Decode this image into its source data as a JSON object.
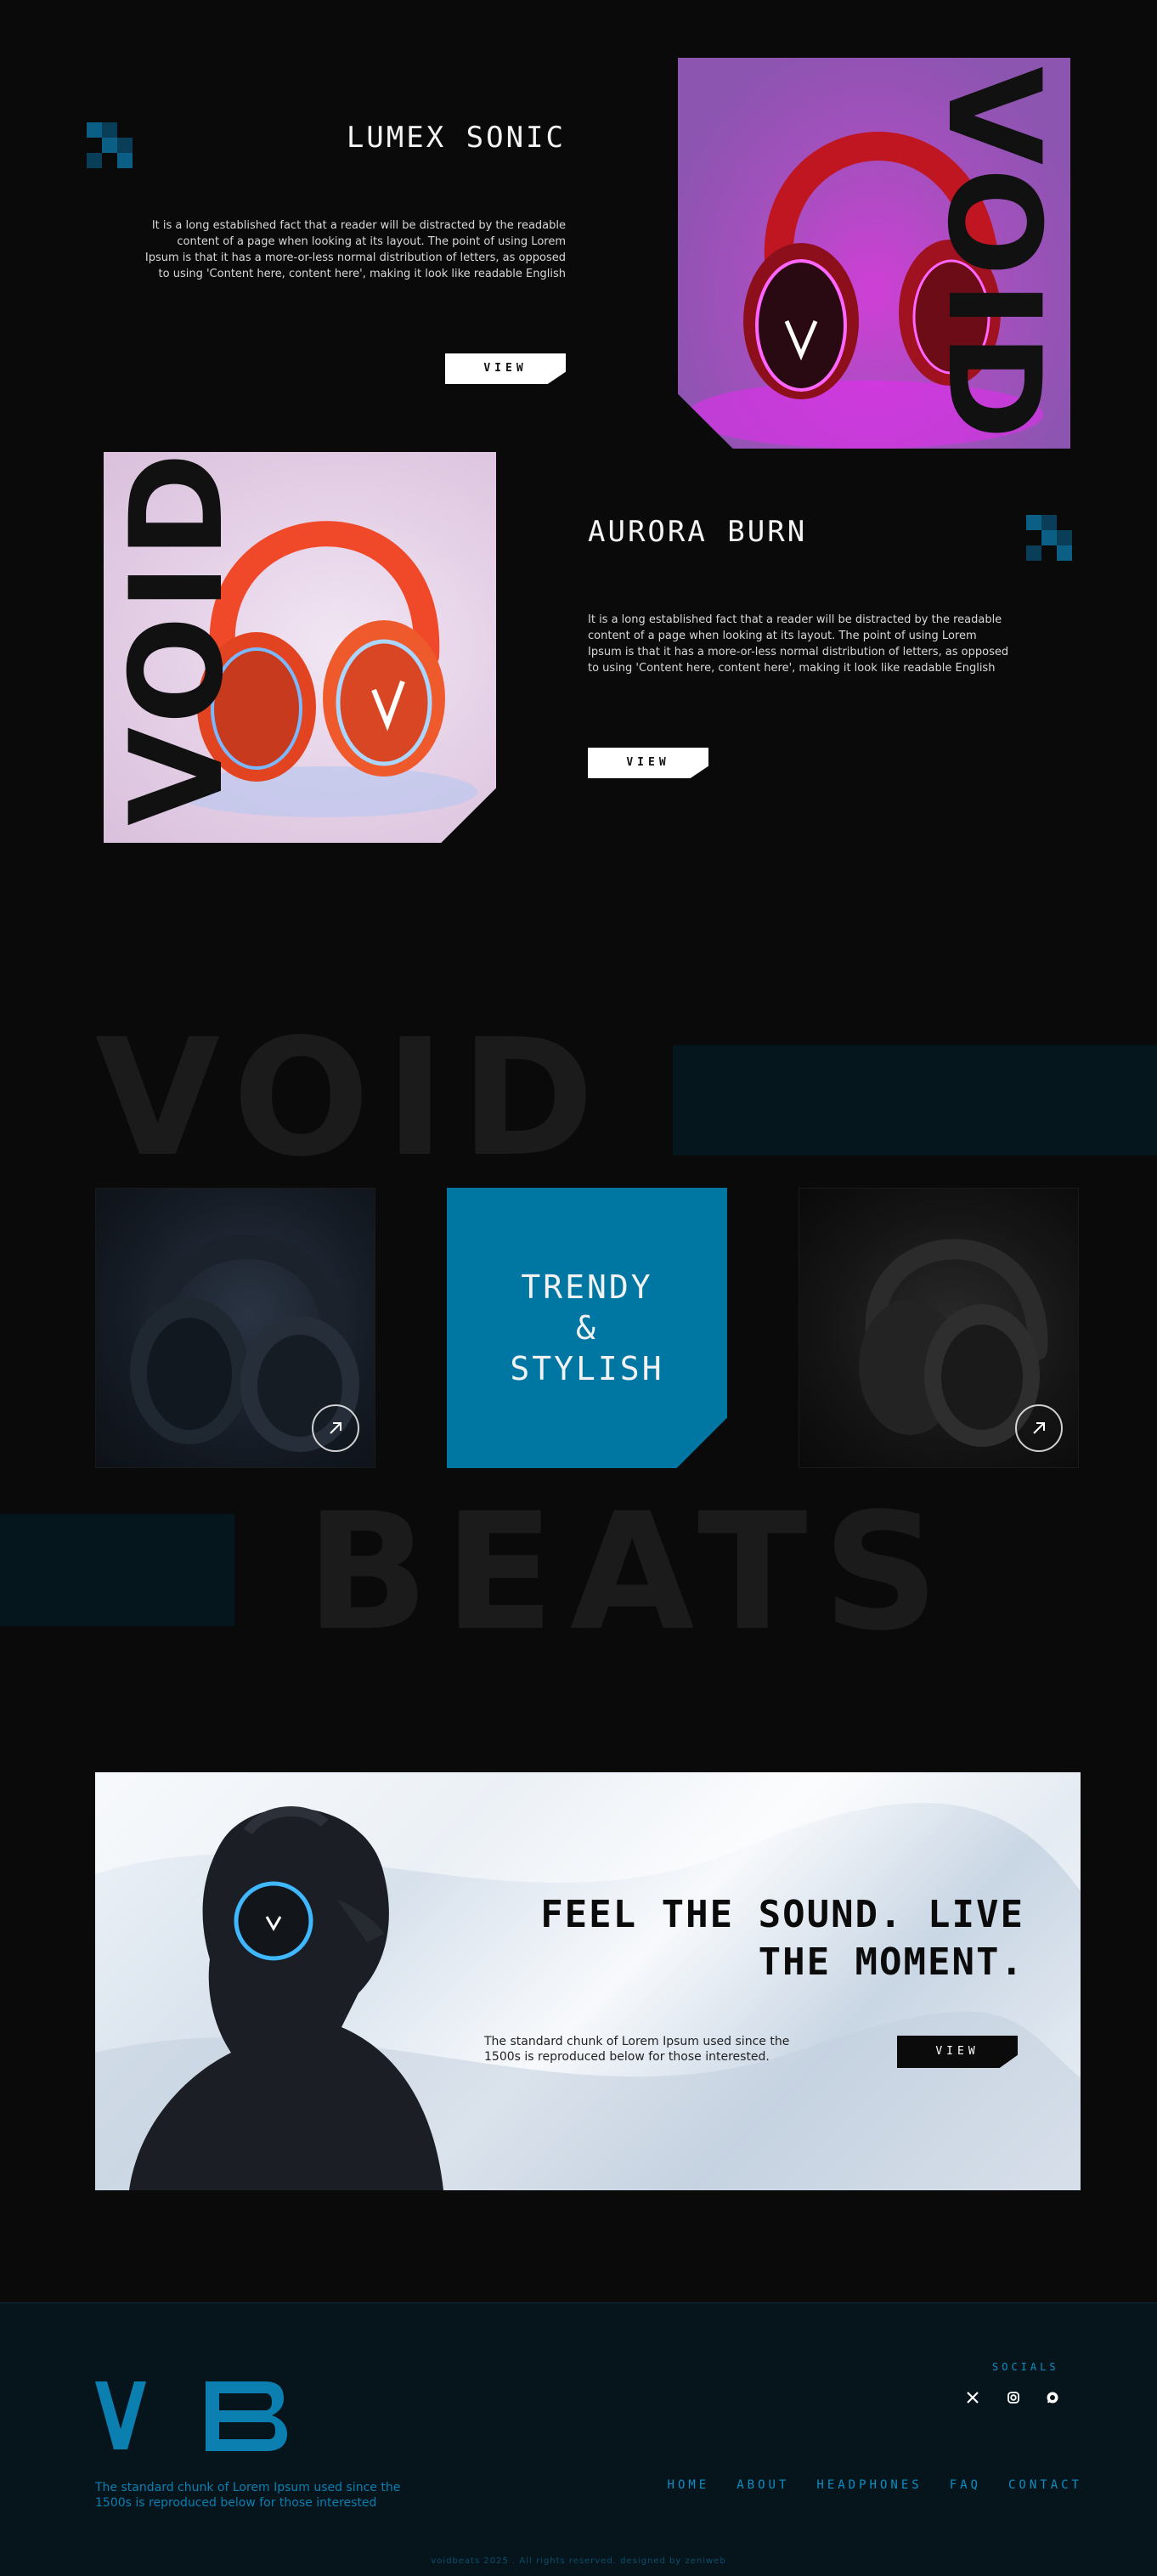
{
  "colors": {
    "background": "#0a0a0a",
    "accent": "#0077a3",
    "footer": "#06141c",
    "footer_text": "#0b8fc4"
  },
  "product1": {
    "title": "LUMEX SONIC",
    "desc": "It is a long established fact that a reader will be distracted by the readable content of a page when looking at its layout. The point of using Lorem Ipsum is that it has a more-or-less normal distribution of letters, as opposed to using 'Content here, content here', making it look like readable English",
    "button": "VIEW",
    "image_word": "VOID"
  },
  "product2": {
    "title": "AURORA BURN",
    "desc": "It is a long established fact that a reader will be distracted by the readable content of a page when looking at its layout. The point of using Lorem Ipsum is that it has a more-or-less normal distribution of letters, as opposed to using 'Content here, content here', making it look like readable English",
    "button": "VIEW",
    "image_word": "VOID"
  },
  "showcase": {
    "word_top": "VOID",
    "word_bottom": "BEATS",
    "center_line1": "TRENDY",
    "center_line2": "&",
    "center_line3": "STYLISH"
  },
  "banner": {
    "headline_line1": "FEEL THE SOUND. LIVE",
    "headline_line2": "THE MOMENT.",
    "text": "The standard chunk of Lorem Ipsum used since the 1500s is reproduced below for those interested.",
    "button": "VIEW"
  },
  "footer": {
    "logo": "VB",
    "tagline": "The standard chunk of Lorem Ipsum used since the 1500s is reproduced below for those interested",
    "socials_label": "SOCIALS",
    "socials": [
      "x-icon",
      "instagram-icon",
      "whatsapp-icon"
    ],
    "nav": [
      "HOME",
      "ABOUT",
      "HEADPHONES",
      "FAQ",
      "CONTACT"
    ],
    "copyright": "voidbeats 2025 . All rights reserved. designed by zeniweb"
  }
}
